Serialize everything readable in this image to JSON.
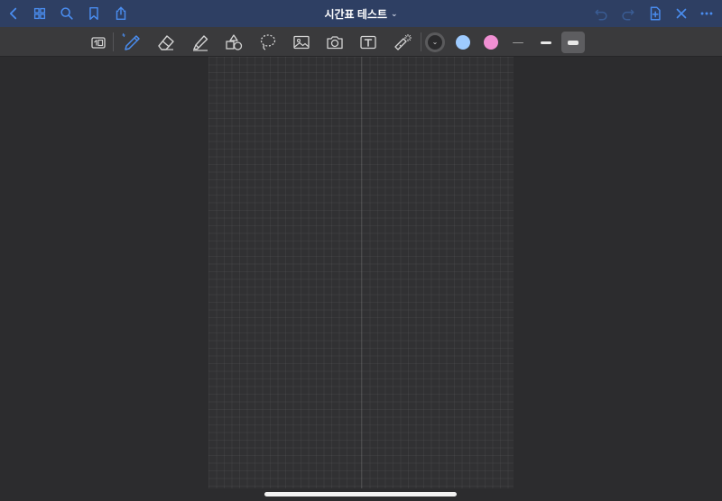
{
  "app": {
    "title": "시간표 테스트",
    "title_chevron": "⌄",
    "accent": "#3b82f6",
    "titlebar_color": "#2e3f63"
  },
  "titlebar": {
    "left_icons": [
      "chevron-left-icon",
      "grid-icon",
      "search-icon",
      "bookmark-icon",
      "share-icon"
    ],
    "right_icons": [
      "undo-icon",
      "redo-icon",
      "add-page-icon",
      "close-icon",
      "more-icon"
    ]
  },
  "toolbar": {
    "tools": [
      "read-only-icon",
      "pen-icon",
      "eraser-icon",
      "highlighter-icon",
      "shapes-icon",
      "lasso-icon",
      "image-icon",
      "camera-icon",
      "text-icon",
      "laser-pointer-icon"
    ],
    "selected_tool": "pen",
    "colors": [
      "#9ecbff",
      "#f08fd3"
    ],
    "stroke_widths": [
      "thin",
      "medium",
      "thick"
    ],
    "selected_stroke": "thick"
  },
  "page": {
    "background": "grid",
    "theme": "dark"
  }
}
